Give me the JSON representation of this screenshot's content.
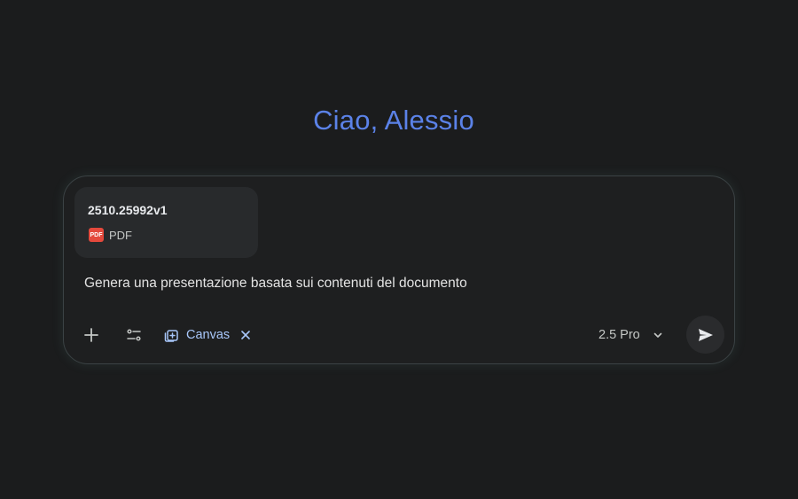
{
  "greeting": "Ciao, Alessio",
  "composer": {
    "attachment": {
      "name": "2510.25992v1",
      "type_label": "PDF",
      "icon_text": "PDF",
      "icon": "pdf-file-icon"
    },
    "prompt": "Genera una presentazione basata sui contenuti del documento",
    "toolbar": {
      "add_icon": "plus-icon",
      "tools_icon": "tools-sliders-icon",
      "canvas_chip": {
        "label": "Canvas",
        "icon": "canvas-icon",
        "close_icon": "close-icon"
      },
      "model": {
        "label": "2.5 Pro",
        "icon": "chevron-down-icon"
      },
      "send_icon": "send-icon"
    }
  },
  "colors": {
    "background": "#1b1c1d",
    "greeting": "#5b82e8",
    "accent": "#a8c7fa",
    "pdf_red": "#e4493c"
  }
}
